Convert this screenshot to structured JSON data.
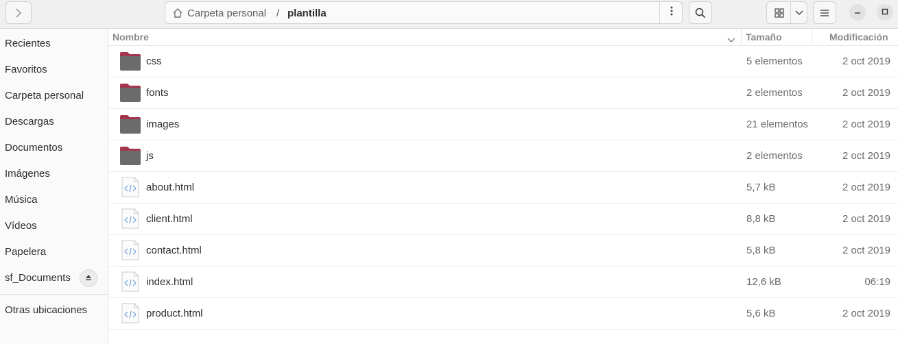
{
  "header": {
    "breadcrumb": [
      "Carpeta personal",
      "plantilla"
    ],
    "separator": "/"
  },
  "sidebar": {
    "items": [
      "Recientes",
      "Favoritos",
      "Carpeta personal",
      "Descargas",
      "Documentos",
      "Imágenes",
      "Música",
      "Vídeos",
      "Papelera",
      "sf_Documents"
    ],
    "other": "Otras ubicaciones"
  },
  "columns": {
    "name": "Nombre",
    "size": "Tamaño",
    "modified": "Modificación"
  },
  "files": [
    {
      "name": "css",
      "size": "5 elementos",
      "date": "2 oct 2019",
      "type": "folder"
    },
    {
      "name": "fonts",
      "size": "2 elementos",
      "date": "2 oct 2019",
      "type": "folder"
    },
    {
      "name": "images",
      "size": "21 elementos",
      "date": "2 oct 2019",
      "type": "folder"
    },
    {
      "name": "js",
      "size": "2 elementos",
      "date": "2 oct 2019",
      "type": "folder"
    },
    {
      "name": "about.html",
      "size": "5,7 kB",
      "date": "2 oct 2019",
      "type": "html"
    },
    {
      "name": "client.html",
      "size": "8,8 kB",
      "date": "2 oct 2019",
      "type": "html"
    },
    {
      "name": "contact.html",
      "size": "5,8 kB",
      "date": "2 oct 2019",
      "type": "html"
    },
    {
      "name": "index.html",
      "size": "12,6 kB",
      "date": "06:19",
      "type": "html"
    },
    {
      "name": "product.html",
      "size": "5,6 kB",
      "date": "2 oct 2019",
      "type": "html"
    }
  ],
  "colors": {
    "folder_body": "#6b6b6b",
    "folder_tab": "#a3364e",
    "accent": "#e95420"
  }
}
